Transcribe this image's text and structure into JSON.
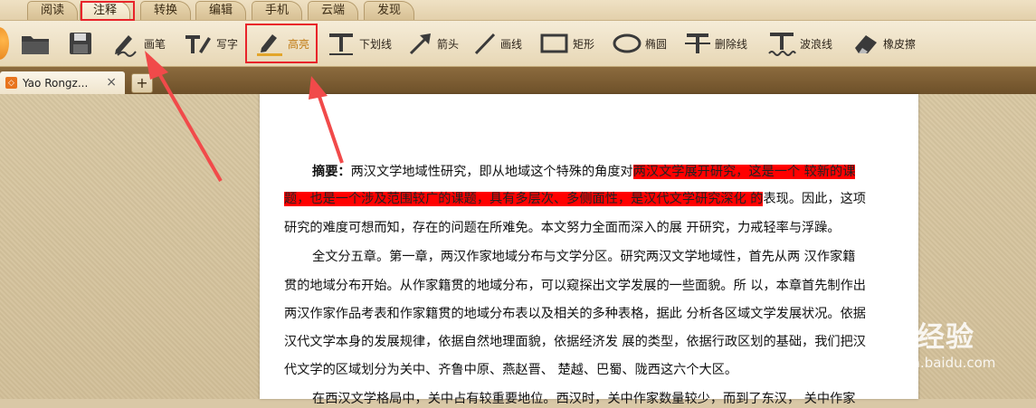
{
  "menu": {
    "tabs": [
      {
        "label": "阅读"
      },
      {
        "label": "注释"
      },
      {
        "label": "转换"
      },
      {
        "label": "编辑"
      },
      {
        "label": "手机"
      },
      {
        "label": "云端"
      },
      {
        "label": "发现"
      }
    ],
    "active": "注释"
  },
  "toolbar": {
    "tools": [
      {
        "label": "画笔",
        "icon": "pen-scribble-icon"
      },
      {
        "label": "写字",
        "icon": "text-write-icon"
      },
      {
        "label": "高亮",
        "icon": "highlight-icon"
      },
      {
        "label": "下划线",
        "icon": "underline-icon"
      },
      {
        "label": "箭头",
        "icon": "arrow-icon"
      },
      {
        "label": "画线",
        "icon": "line-icon"
      },
      {
        "label": "矩形",
        "icon": "rectangle-icon"
      },
      {
        "label": "椭圆",
        "icon": "ellipse-icon"
      },
      {
        "label": "删除线",
        "icon": "strikethrough-icon"
      },
      {
        "label": "波浪线",
        "icon": "wavy-underline-icon"
      },
      {
        "label": "橡皮擦",
        "icon": "eraser-icon"
      }
    ],
    "highlight_color": "#c07a12"
  },
  "document_tab": {
    "title": "Yao Rongz...",
    "close": "×",
    "new_tab": "+"
  },
  "document": {
    "abstract_label": "摘要：",
    "lines": [
      {
        "pre": "两汉文学地域性研究，即从地域这个特殊的角度对",
        "hl": "两汉文学展开研究，这是一个 较新的课"
      },
      {
        "hl": "题，也是一个涉及范围较广的课题，具有多层次、多侧面性，是汉代文学研究深化 的",
        "post": "表现。因此，这项"
      },
      {
        "text": "研究的难度可想而知，存在的问题在所难免。本文努力全面而深入的展 开研究，力戒轻率与浮躁。"
      },
      {
        "text": "全文分五章。第一章，两汉作家地域分布与文学分区。研究两汉文学地域性，首先从两 汉作家籍"
      },
      {
        "text": "贯的地域分布开始。从作家籍贯的地域分布，可以窥探出文学发展的一些面貌。所 以，本章首先制作出"
      },
      {
        "text": "两汉作家作品考表和作家籍贯的地域分布表以及相关的多种表格，据此 分析各区域文学发展状况。依据"
      },
      {
        "text": "汉代文学本身的发展规律，依据自然地理面貌，依据经济发 展的类型，依据行政区划的基础，我们把汉"
      },
      {
        "text": "代文学的区域划分为关中、齐鲁中原、燕赵晋、 楚越、巴蜀、陇西这六个大区。"
      },
      {
        "text": "在西汉文学格局中，关中占有较重要地位。西汉时，关中作家数量较少，而到了东汉， 关中作家"
      }
    ],
    "highlight_color": "#ff0000"
  },
  "watermark": {
    "brand": "经验",
    "url": "jingyan.baidu.com"
  },
  "annotation_color": "#e8242a"
}
